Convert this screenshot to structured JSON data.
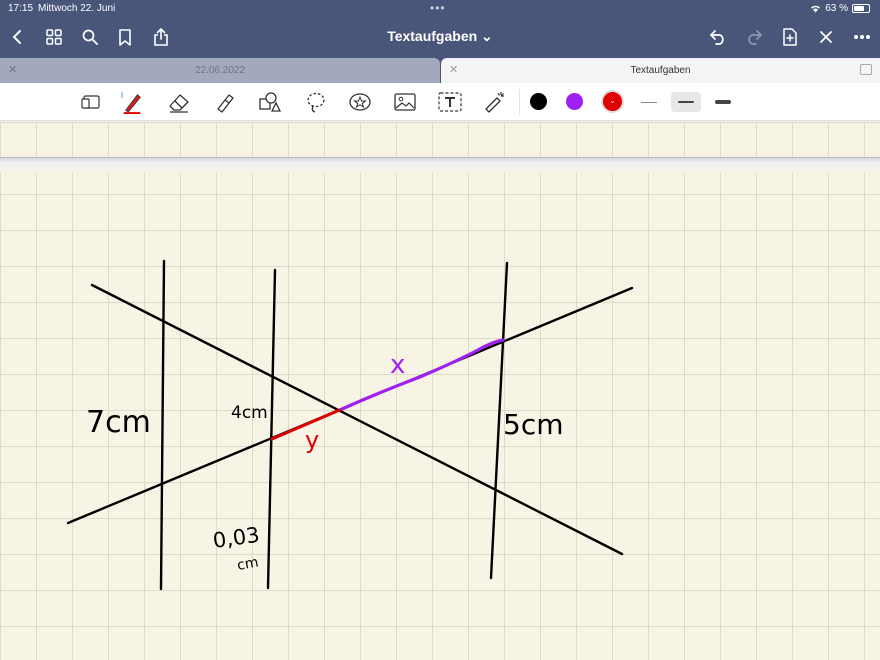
{
  "status": {
    "time": "17:15",
    "date": "Mittwoch 22. Juni",
    "battery": "63 %"
  },
  "nav": {
    "title": "Textaufgaben ⌄"
  },
  "tabs": [
    {
      "label": "22.06.2022",
      "active": false
    },
    {
      "label": "Textaufgaben",
      "active": true
    }
  ],
  "toolbar": {
    "tools": [
      "sidebar-toggle-icon",
      "pen-icon",
      "eraser-icon",
      "highlighter-icon",
      "shapes-icon",
      "lasso-icon",
      "sticker-icon",
      "image-icon",
      "text-icon",
      "laser-pointer-icon"
    ],
    "colors": [
      "#000000",
      "#a020f0",
      "#e00000"
    ],
    "selected_color": "#e00000",
    "stroke_widths": [
      "thin",
      "medium",
      "thick"
    ],
    "selected_stroke": "medium"
  },
  "drawing": {
    "labels": {
      "left_length": "7cm",
      "middle_length": "4cm",
      "right_length": "5cm",
      "bottom_length_value": "0,03",
      "bottom_length_unit": "cm",
      "var_x": "x",
      "var_y": "y"
    },
    "colors": {
      "ink": "#000000",
      "purple": "#a020f0",
      "red": "#e00000"
    }
  }
}
